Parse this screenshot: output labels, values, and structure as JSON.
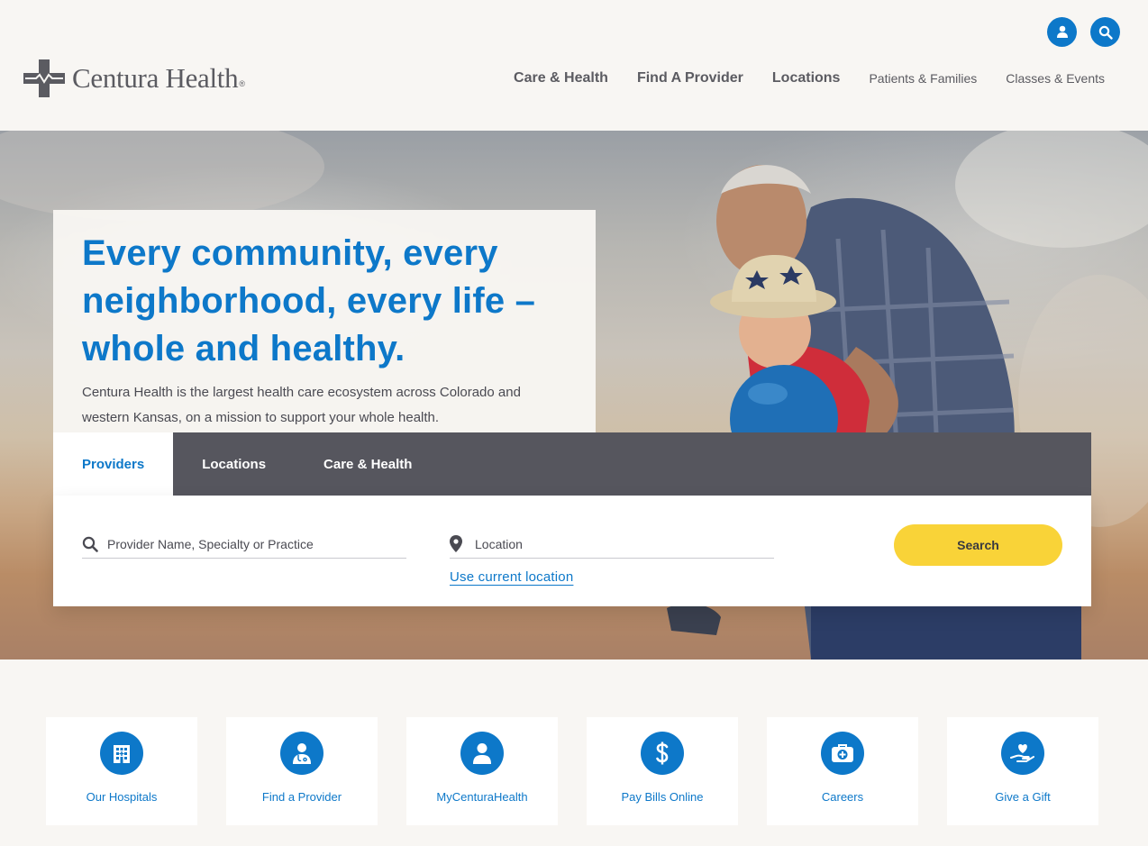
{
  "brand": {
    "name": "Centura Health",
    "registered": "®",
    "primary_color": "#0d78c9",
    "accent_color": "#f9d338",
    "dark_color": "#56565e"
  },
  "header": {
    "utility": [
      {
        "icon": "account-icon"
      },
      {
        "icon": "search-icon"
      }
    ],
    "nav": [
      {
        "label": "Care & Health"
      },
      {
        "label": "Find A Provider"
      },
      {
        "label": "Locations"
      },
      {
        "label": "Patients & Families"
      },
      {
        "label": "Classes & Events"
      }
    ]
  },
  "hero": {
    "title": "Every community, every neighborhood, every life – whole and healthy.",
    "subtitle": "Centura Health is the largest health care ecosystem across Colorado and western Kansas, on a mission to support your whole health."
  },
  "search": {
    "tabs": [
      {
        "label": "Providers",
        "active": true
      },
      {
        "label": "Locations",
        "active": false
      },
      {
        "label": "Care & Health",
        "active": false
      }
    ],
    "provider_placeholder": "Provider Name, Specialty or Practice",
    "location_placeholder": "Location",
    "use_location": "Use current location",
    "button": "Search"
  },
  "quick_links": [
    {
      "label": "Our Hospitals",
      "icon": "hospital-icon"
    },
    {
      "label": "Find a Provider",
      "icon": "doctor-icon"
    },
    {
      "label": "MyCenturaHealth",
      "icon": "person-icon"
    },
    {
      "label": "Pay Bills Online",
      "icon": "dollar-icon"
    },
    {
      "label": "Careers",
      "icon": "medical-bag-icon"
    },
    {
      "label": "Give a Gift",
      "icon": "heart-hand-icon"
    }
  ]
}
